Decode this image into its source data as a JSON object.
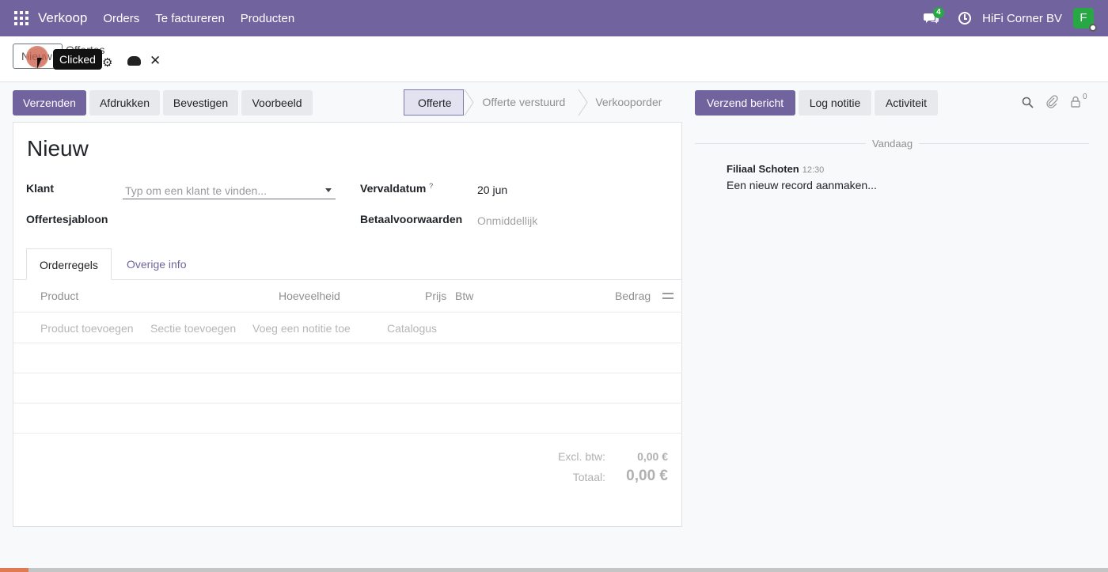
{
  "topbar": {
    "brand": "Verkoop",
    "menu": [
      "Orders",
      "Te factureren",
      "Producten"
    ],
    "message_count": "4",
    "company": "HiFi Corner BV",
    "avatar_initial": "F"
  },
  "controlpanel": {
    "new_label": "Nieuw",
    "breadcrumb": "Offertes",
    "tooltip": "Clicked",
    "icons": [
      "gear-icon",
      "cloud-upload-icon",
      "close-icon"
    ]
  },
  "actions": {
    "send": "Verzenden",
    "print": "Afdrukken",
    "confirm": "Bevestigen",
    "preview": "Voorbeeld"
  },
  "statusbar": {
    "stages": [
      "Offerte",
      "Offerte verstuurd",
      "Verkooporder"
    ],
    "active": "Offerte"
  },
  "form": {
    "title": "Nieuw",
    "customer_label": "Klant",
    "customer_placeholder": "Typ om een klant te vinden...",
    "template_label": "Offertesjabloon",
    "expiry_label": "Vervaldatum",
    "expiry_help": "?",
    "expiry_value": "20 jun",
    "payment_terms_label": "Betaalvoorwaarden",
    "payment_terms_placeholder": "Onmiddellijk"
  },
  "tabs": [
    "Orderregels",
    "Overige info"
  ],
  "table": {
    "columns": [
      "Product",
      "Hoeveelheid",
      "Prijs",
      "Btw",
      "Bedrag"
    ],
    "add_links": [
      "Product toevoegen",
      "Sectie toevoegen",
      "Voeg een notitie toe",
      "Catalogus"
    ]
  },
  "totals": {
    "untaxed_label": "Excl. btw:",
    "untaxed_value": "0,00 €",
    "total_label": "Totaal:",
    "total_value": "0,00 €"
  },
  "chatter": {
    "send_message": "Verzend bericht",
    "log_note": "Log notitie",
    "activity": "Activiteit",
    "follower_count": "0",
    "day_label": "Vandaag",
    "author": "Filiaal Schoten",
    "time": "12:30",
    "message": "Een nieuw record aanmaken..."
  },
  "colors": {
    "brand": "#71639e",
    "success": "#28a745"
  }
}
